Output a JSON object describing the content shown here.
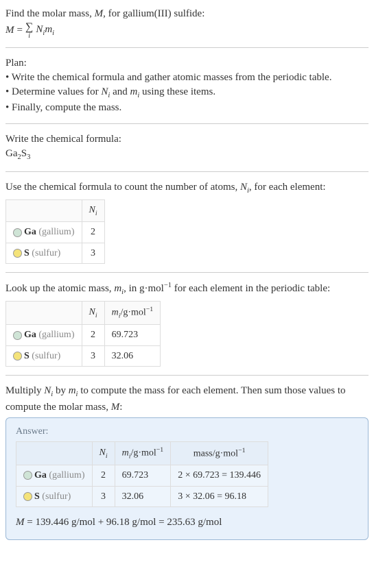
{
  "intro": {
    "line1_prefix": "Find the molar mass, ",
    "line1_M": "M",
    "line1_suffix": ", for gallium(III) sulfide:",
    "eq_M": "M",
    "eq_equals": " = ",
    "eq_sigma": "∑",
    "eq_sigma_sub": "i",
    "eq_term_N": "N",
    "eq_term_i1": "i",
    "eq_term_m": "m",
    "eq_term_i2": "i"
  },
  "plan": {
    "title": "Plan:",
    "b1": "• Write the chemical formula and gather atomic masses from the periodic table.",
    "b2_prefix": "• Determine values for ",
    "b2_N": "N",
    "b2_i1": "i",
    "b2_and": " and ",
    "b2_m": "m",
    "b2_i2": "i",
    "b2_suffix": " using these items.",
    "b3": "• Finally, compute the mass."
  },
  "step_formula": {
    "title": "Write the chemical formula:",
    "ga": "Ga",
    "ga_n": "2",
    "s": "S",
    "s_n": "3"
  },
  "step_count": {
    "line_prefix": "Use the chemical formula to count the number of atoms, ",
    "line_N": "N",
    "line_i": "i",
    "line_suffix": ", for each element:",
    "table": {
      "h_Ni": "N",
      "h_i": "i",
      "rows": [
        {
          "swatch": "#cfe4d6",
          "sym": "Ga",
          "name": "(gallium)",
          "n": "2"
        },
        {
          "swatch": "#f4e37a",
          "sym": "S",
          "name": "(sulfur)",
          "n": "3"
        }
      ]
    }
  },
  "step_mass": {
    "line_prefix": "Look up the atomic mass, ",
    "line_m": "m",
    "line_i": "i",
    "line_mid": ", in g·mol",
    "line_exp": "−1",
    "line_suffix": " for each element in the periodic table:",
    "table": {
      "h_Ni": "N",
      "h_Ni_i": "i",
      "h_mi": "m",
      "h_mi_i": "i",
      "h_unit_pre": "/g·mol",
      "h_unit_exp": "−1",
      "rows": [
        {
          "swatch": "#cfe4d6",
          "sym": "Ga",
          "name": "(gallium)",
          "n": "2",
          "m": "69.723"
        },
        {
          "swatch": "#f4e37a",
          "sym": "S",
          "name": "(sulfur)",
          "n": "3",
          "m": "32.06"
        }
      ]
    }
  },
  "step_compute": {
    "line_p1": "Multiply ",
    "line_N": "N",
    "line_Ni": "i",
    "line_p2": " by ",
    "line_m": "m",
    "line_mi": "i",
    "line_p3": " to compute the mass for each element. Then sum those values to compute the molar mass, ",
    "line_M": "M",
    "line_p4": ":"
  },
  "answer": {
    "label": "Answer:",
    "table": {
      "h_Ni": "N",
      "h_Ni_i": "i",
      "h_mi": "m",
      "h_mi_i": "i",
      "h_mi_unit_pre": "/g·mol",
      "h_mi_unit_exp": "−1",
      "h_mass_pre": "mass/g·mol",
      "h_mass_exp": "−1",
      "rows": [
        {
          "swatch": "#cfe4d6",
          "sym": "Ga",
          "name": "(gallium)",
          "n": "2",
          "m": "69.723",
          "calc": "2 × 69.723 = 139.446"
        },
        {
          "swatch": "#f4e37a",
          "sym": "S",
          "name": "(sulfur)",
          "n": "3",
          "m": "32.06",
          "calc": "3 × 32.06 = 96.18"
        }
      ]
    },
    "final_M": "M",
    "final_eq": " = 139.446 g/mol + 96.18 g/mol = 235.63 g/mol"
  }
}
